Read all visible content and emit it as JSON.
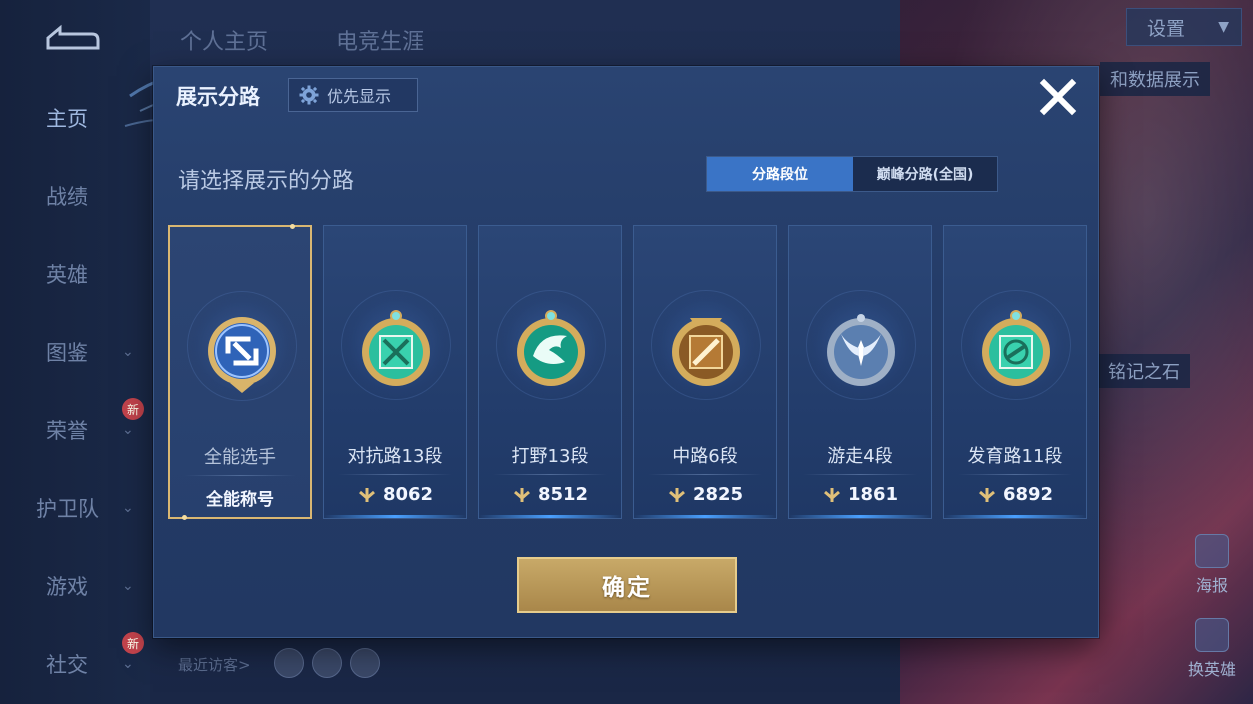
{
  "sidebar": {
    "items": [
      {
        "label": "主页"
      },
      {
        "label": "战绩"
      },
      {
        "label": "英雄"
      },
      {
        "label": "图鉴"
      },
      {
        "label": "荣誉"
      },
      {
        "label": "护卫队"
      },
      {
        "label": "游戏"
      },
      {
        "label": "社交"
      }
    ],
    "new_badge": "新"
  },
  "top_tabs": [
    "个人主页",
    "电竞生涯"
  ],
  "settings_label": "设置",
  "background_peek": {
    "data_display": "和数据展示",
    "stone": "铭记之石",
    "recent_visitors": "最近访客>",
    "poster": "海报",
    "switch_hero": "换英雄"
  },
  "modal": {
    "title": "展示分路",
    "priority_label": "优先显示",
    "prompt": "请选择展示的分路",
    "toggle": {
      "options": [
        "分路段位",
        "巅峰分路(全国)"
      ],
      "selected": "分路段位"
    },
    "cards": [
      {
        "name": "全能选手",
        "bottom": "全能称号",
        "selected": true,
        "emblem": "all-round-emblem-icon"
      },
      {
        "name": "对抗路13段",
        "score": "8062",
        "emblem": "clash-lane-emblem-icon"
      },
      {
        "name": "打野13段",
        "score": "8512",
        "emblem": "jungle-emblem-icon"
      },
      {
        "name": "中路6段",
        "score": "2825",
        "emblem": "mid-lane-emblem-icon"
      },
      {
        "name": "游走4段",
        "score": "1861",
        "emblem": "roam-emblem-icon"
      },
      {
        "name": "发育路11段",
        "score": "6892",
        "emblem": "farm-lane-emblem-icon"
      }
    ],
    "confirm_label": "确定"
  },
  "colors": {
    "gold": "#d9b772",
    "toggle_active": "#3a74c6",
    "teal_emblem": "#2bbf9e"
  }
}
